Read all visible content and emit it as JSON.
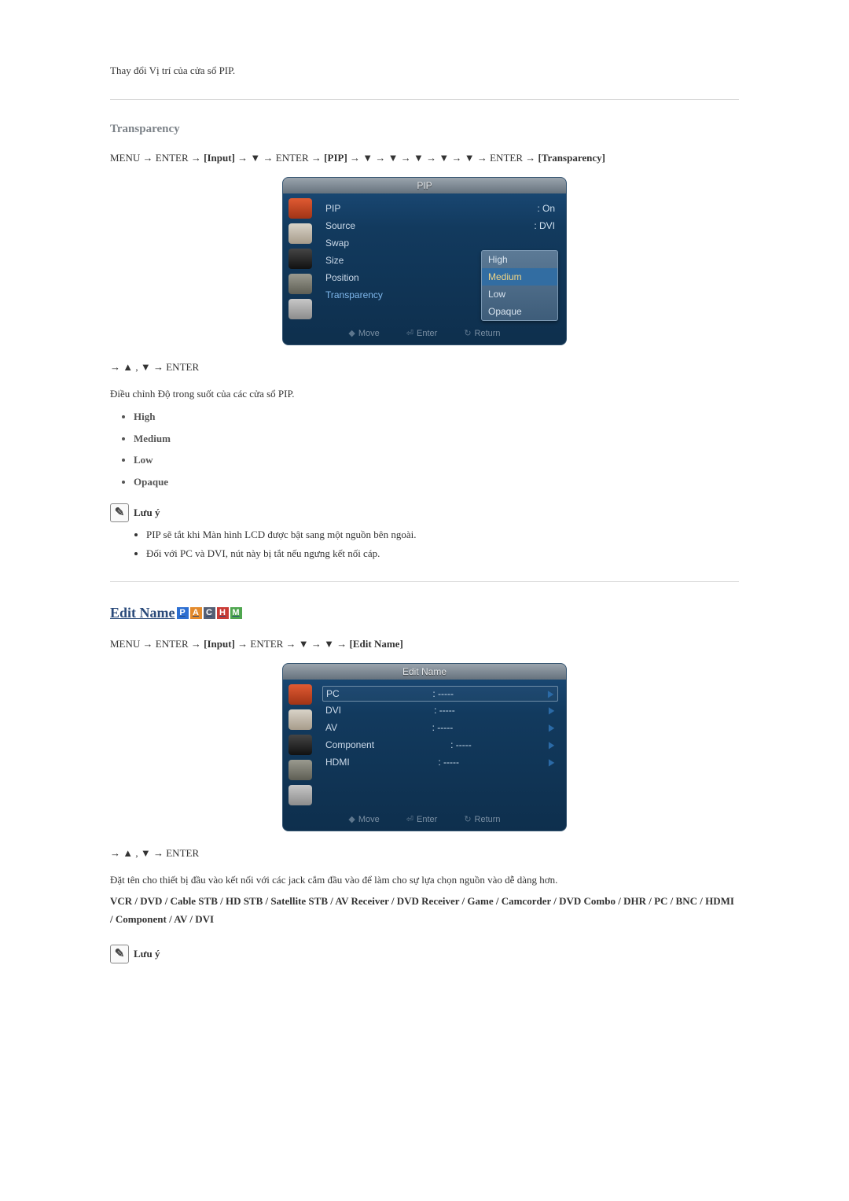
{
  "top_text": "Thay đổi Vị trí của cửa sổ PIP.",
  "transparency": {
    "heading": "Transparency",
    "path_pre": "MENU → ENTER → ",
    "word_input": "[Input]",
    "path_mid1": " → ▼ → ENTER → ",
    "word_pip": "[PIP]",
    "path_mid2": " → ▼ → ▼ → ▼ → ▼ → ▼ → ENTER → ",
    "word_transp": "[Transparency]",
    "nav_after": "→ ▲ , ▼ → ENTER",
    "desc": "Điều chỉnh Độ trong suốt của các cửa sổ PIP.",
    "options": [
      "High",
      "Medium",
      "Low",
      "Opaque"
    ]
  },
  "osd1": {
    "title": "PIP",
    "rows": {
      "pip": "PIP",
      "pip_v": ": On",
      "source": "Source",
      "source_v": ": DVI",
      "swap": "Swap",
      "size": "Size",
      "position": "Position",
      "transparency": "Transparency"
    },
    "drop": {
      "high": "High",
      "medium": "Medium",
      "low": "Low",
      "opaque": "Opaque"
    },
    "footer": {
      "move": "Move",
      "enter": "Enter",
      "return": "Return",
      "km": "◆",
      "ke": "⏎",
      "kr": "↻"
    }
  },
  "note1": {
    "title": "Lưu ý",
    "items": [
      "PIP sẽ tắt khi Màn hình LCD được bật sang một nguồn bên ngoài.",
      "Đối với PC và DVI, nút này bị tắt nếu ngưng kết nối cáp."
    ]
  },
  "editname": {
    "heading": "Edit Name",
    "badges": {
      "p": "P",
      "a": "A",
      "c": "C",
      "h": "H",
      "m": "M"
    },
    "path_pre": "MENU → ENTER → ",
    "word_input": "[Input]",
    "path_mid": " → ENTER → ▼ → ▼ → ",
    "word_edit": "[Edit Name]",
    "nav_after": "→ ▲ , ▼ → ENTER",
    "desc": "Đặt tên cho thiết bị đầu vào kết nối với các jack cắm đầu vào để làm cho sự lựa chọn nguồn vào dễ dàng hơn.",
    "names": "VCR / DVD / Cable STB / HD STB / Satellite STB / AV Receiver / DVD Receiver / Game / Camcorder / DVD Combo / DHR / PC / BNC / HDMI / Component / AV / DVI"
  },
  "osd2": {
    "title": "Edit Name",
    "rows": {
      "pc": "PC",
      "dvi": "DVI",
      "av": "AV",
      "component": "Component",
      "hdmi": "HDMI",
      "dash": ": -----"
    },
    "footer": {
      "move": "Move",
      "enter": "Enter",
      "return": "Return",
      "km": "◆",
      "ke": "⏎",
      "kr": "↻"
    }
  },
  "note2": {
    "title": "Lưu ý"
  }
}
